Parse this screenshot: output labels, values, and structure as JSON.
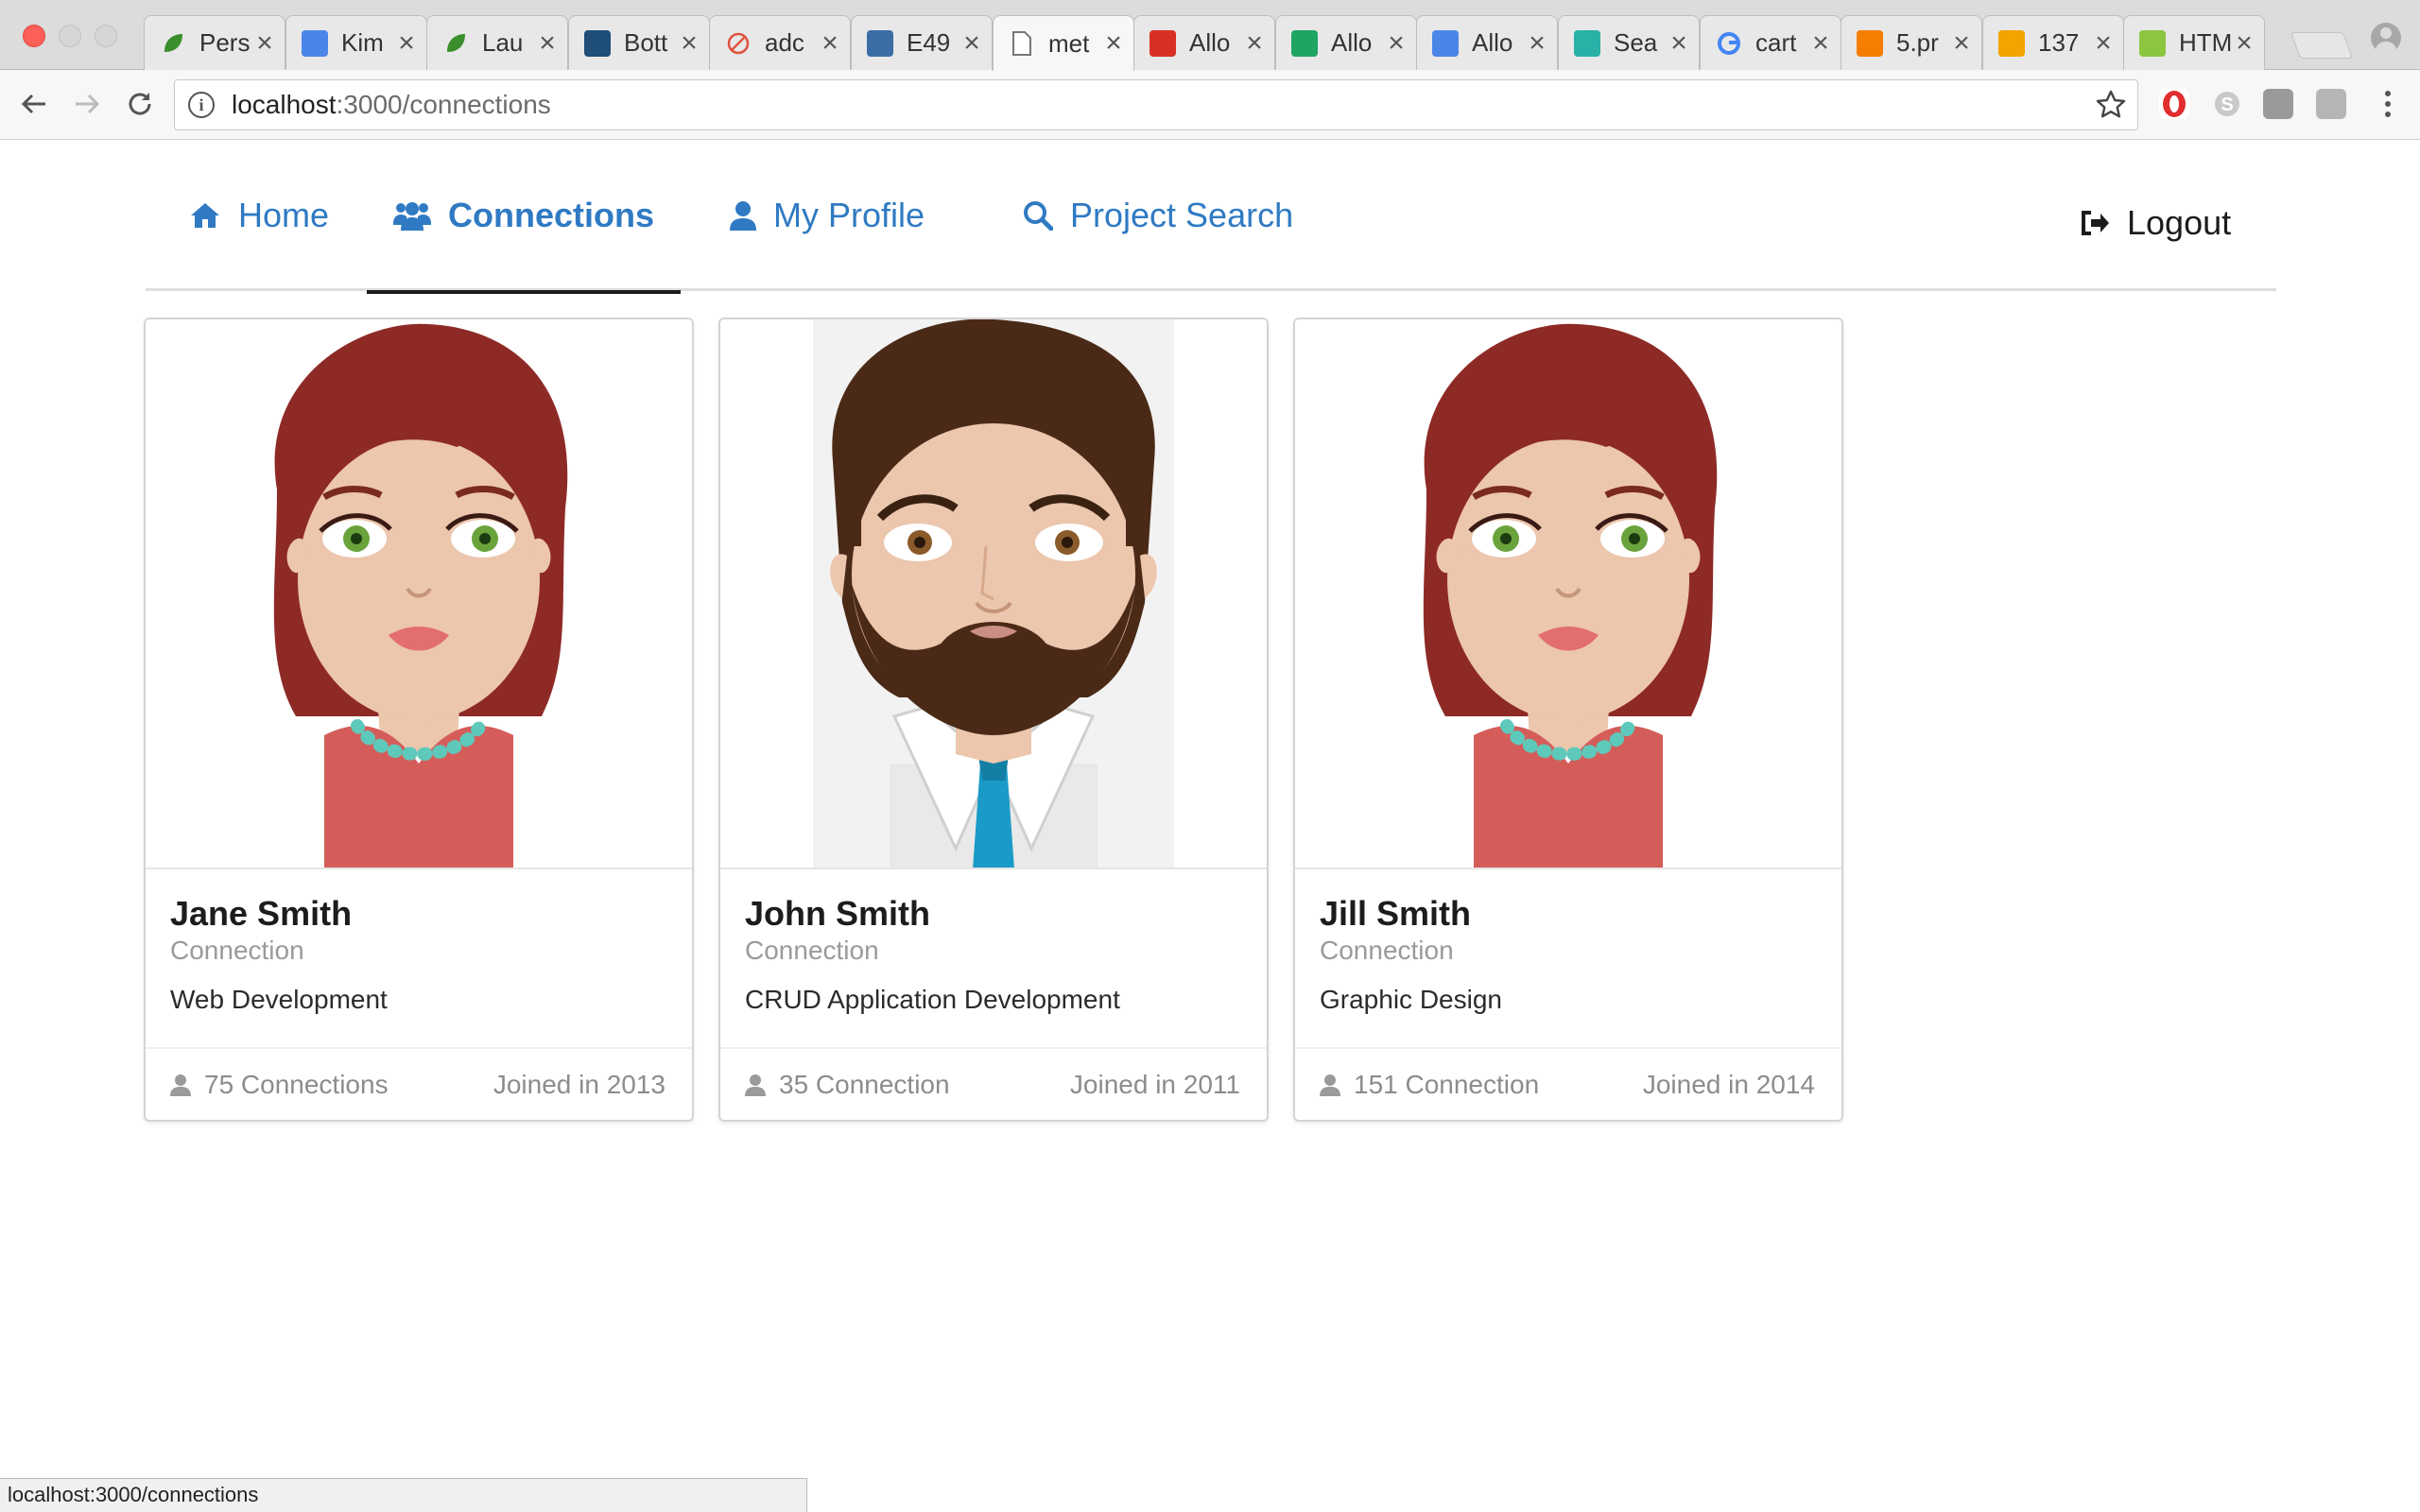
{
  "browser": {
    "tabs": [
      {
        "title": "Pers",
        "icon": "leaf-icon",
        "color": "#3a8f2c"
      },
      {
        "title": "Kim",
        "icon": "docs-icon",
        "color": "#4a86e8"
      },
      {
        "title": "Lau",
        "icon": "leaf-icon",
        "color": "#3a8f2c"
      },
      {
        "title": "Bott",
        "icon": "bi-icon",
        "color": "#1f4e79"
      },
      {
        "title": "adc",
        "icon": "slash-circle-icon",
        "color": "#e0533f"
      },
      {
        "title": "E49",
        "icon": "square-icon",
        "color": "#3b6ea5"
      },
      {
        "title": "met",
        "icon": "page-icon",
        "color": "#777777"
      },
      {
        "title": "Allo",
        "icon": "gmail-icon",
        "color": "#d93025"
      },
      {
        "title": "Allo",
        "icon": "drive-icon",
        "color": "#1fa463"
      },
      {
        "title": "Allo",
        "icon": "docs-icon",
        "color": "#4a86e8"
      },
      {
        "title": "Sea",
        "icon": "s-icon",
        "color": "#29b1a7"
      },
      {
        "title": "cart",
        "icon": "google-icon",
        "color": "#4285f4"
      },
      {
        "title": "5.pr",
        "icon": "blogger-icon",
        "color": "#f57d00"
      },
      {
        "title": "137",
        "icon": "scissors-icon",
        "color": "#f5a300"
      },
      {
        "title": "HTM",
        "icon": "w3-icon",
        "color": "#8cc63f"
      }
    ],
    "active_tab": 6,
    "url_host": "localhost",
    "url_path": ":3000/connections",
    "status_url": "localhost:3000/connections"
  },
  "nav": {
    "home": "Home",
    "connections": "Connections",
    "profile": "My Profile",
    "search": "Project Search",
    "logout": "Logout"
  },
  "cards": [
    {
      "name": "Jane Smith",
      "meta": "Connection",
      "description": "Web Development",
      "connections": "75 Connections",
      "joined": "Joined in 2013",
      "avatar": "female-avatar"
    },
    {
      "name": "John Smith",
      "meta": "Connection",
      "description": "CRUD Application Development",
      "connections": "35 Connection",
      "joined": "Joined in 2011",
      "avatar": "male-avatar"
    },
    {
      "name": "Jill Smith",
      "meta": "Connection",
      "description": "Graphic Design",
      "connections": "151 Connection",
      "joined": "Joined in 2014",
      "avatar": "female-avatar"
    }
  ],
  "colors": {
    "link": "#2f7ac3",
    "active_underline": "#1b1c1d",
    "hair": "#8e2a26",
    "skin": "#ecc6ad",
    "male_hair": "#4a2a17",
    "tie": "#1a9bc7"
  }
}
